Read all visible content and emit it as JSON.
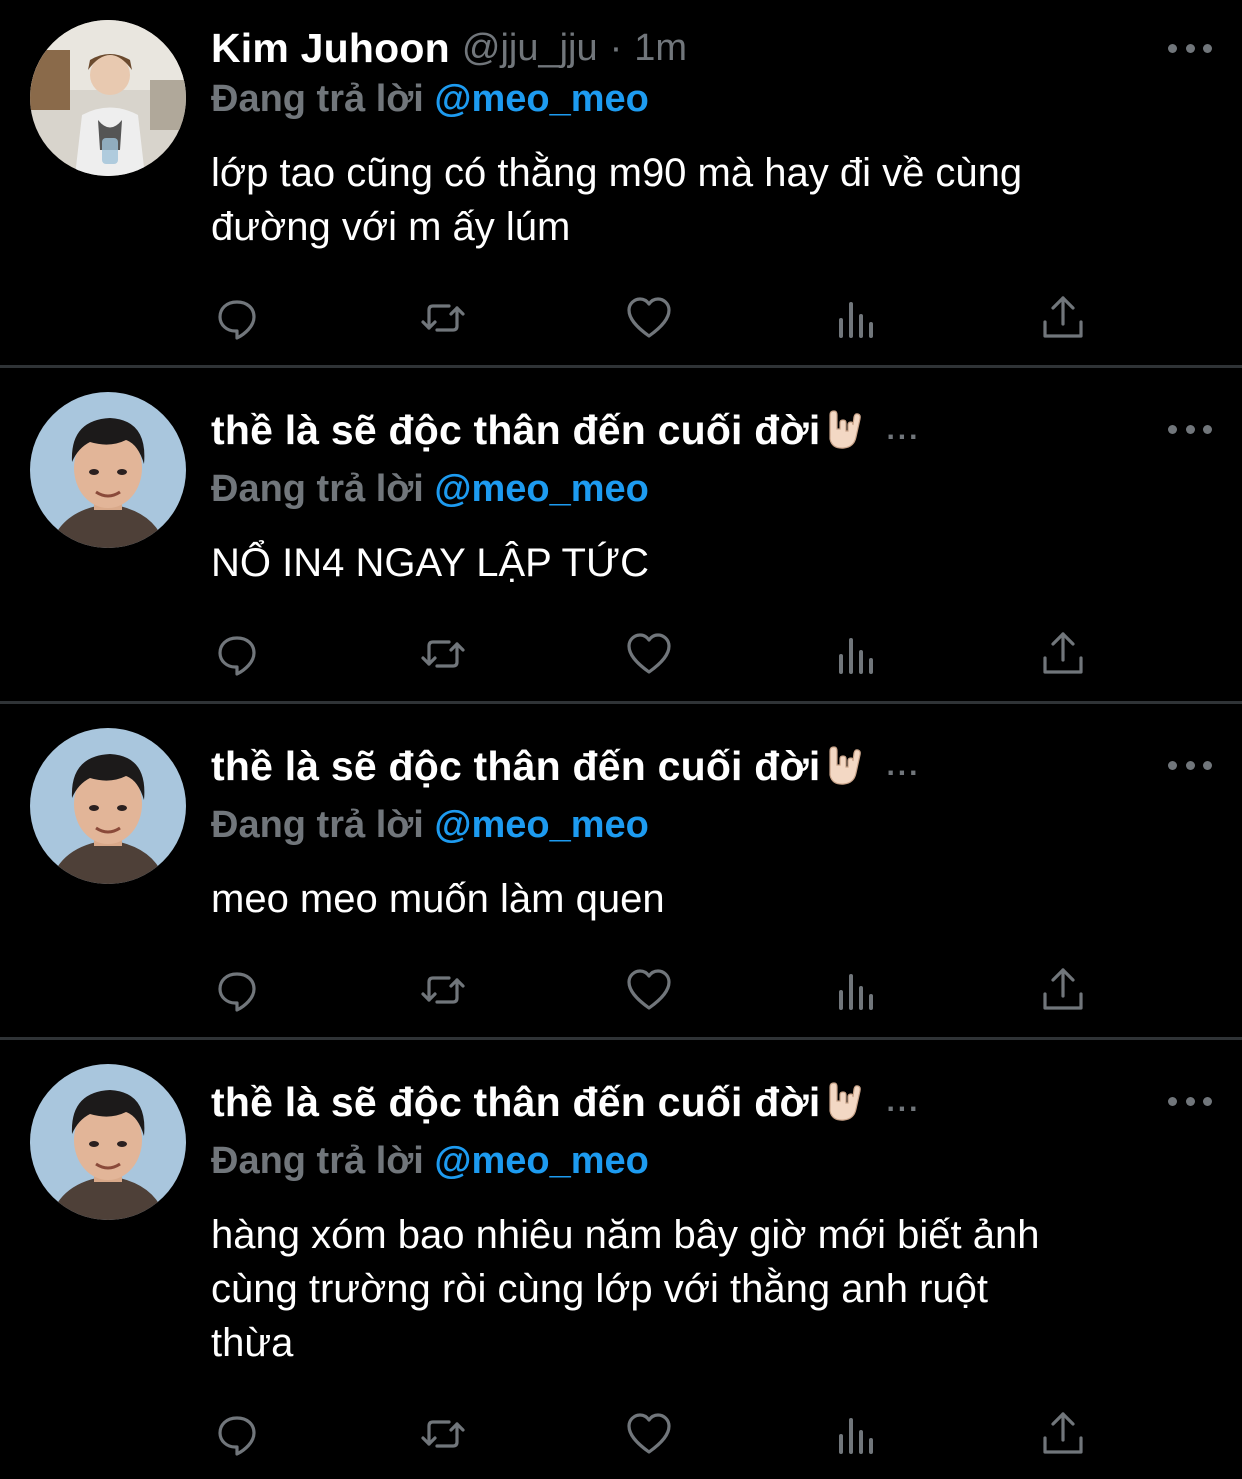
{
  "tweets": [
    {
      "author_name": "Kim Juhoon",
      "author_handle": "@jju_jju",
      "separator": "·",
      "time": "1m",
      "reply_prefix": "Đang trả lời",
      "reply_to": "@meo_meo",
      "text_lines": [
        "lớp tao cũng có thằng m90 mà hay đi về cùng",
        "đường với m ấy lúm"
      ],
      "avatar": "avatar-photo"
    },
    {
      "author_name": "thề là sẽ độc thân đến cuối đời",
      "name_truncation": "...",
      "emoji": "sign-of-horns-emoji",
      "reply_prefix": "Đang trả lời",
      "reply_to": "@meo_meo",
      "text_lines": [
        "NỔ IN4 NGAY LẬP TỨC"
      ],
      "avatar": "avatar-photo"
    },
    {
      "author_name": "thề là sẽ độc thân đến cuối đời",
      "name_truncation": "...",
      "emoji": "sign-of-horns-emoji",
      "reply_prefix": "Đang trả lời",
      "reply_to": "@meo_meo",
      "text_lines": [
        "meo meo muốn làm quen"
      ],
      "avatar": "avatar-photo"
    },
    {
      "author_name": "thề là sẽ độc thân đến cuối đời",
      "name_truncation": "...",
      "emoji": "sign-of-horns-emoji",
      "reply_prefix": "Đang trả lời",
      "reply_to": "@meo_meo",
      "text_lines": [
        "hàng xóm bao nhiêu năm bây giờ mới biết ảnh",
        "cùng trường ròi cùng lớp với thằng anh ruột",
        "thừa"
      ],
      "avatar": "avatar-photo"
    }
  ],
  "action_icons": [
    "reply-icon",
    "retweet-icon",
    "like-icon",
    "analytics-icon",
    "share-icon"
  ],
  "colors": {
    "background": "#000000",
    "text": "#ffffff",
    "secondary": "#71767b",
    "mention": "#1d9bf0",
    "divider": "#2f3336"
  }
}
